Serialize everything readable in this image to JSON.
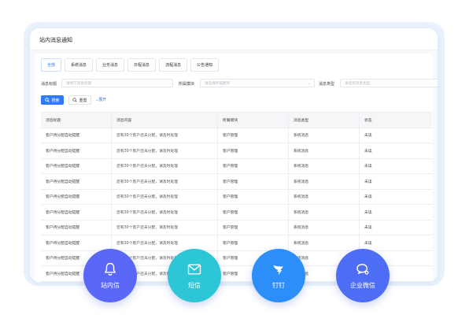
{
  "panel": {
    "title": "站内消息通知"
  },
  "tabs": [
    {
      "label": "全部",
      "active": true
    },
    {
      "label": "系统消息",
      "active": false
    },
    {
      "label": "业务消息",
      "active": false
    },
    {
      "label": "日程消息",
      "active": false
    },
    {
      "label": "流程消息",
      "active": false
    },
    {
      "label": "公告通知",
      "active": false
    }
  ],
  "filters": {
    "title_label": "消息标题",
    "title_placeholder": "请填写消息标题",
    "module_label": "所属模块",
    "module_placeholder": "请选择所属模块",
    "type_label": "消息类型",
    "type_placeholder": "请选择消息类型"
  },
  "buttons": {
    "search": "搜索",
    "reset": "重置",
    "expand": "展开"
  },
  "table": {
    "headers": [
      "消息标题",
      "消息内容",
      "所属模块",
      "消息类型",
      "状态"
    ],
    "rows": [
      [
        "客户待分配自动提醒",
        "您有30个客户还未分配，请及时处理",
        "客户管理",
        "系统消息",
        "未读"
      ],
      [
        "客户待分配自动提醒",
        "您有30个客户还未分配，请及时处理",
        "客户管理",
        "系统消息",
        "未读"
      ],
      [
        "客户待分配自动提醒",
        "您有30个客户还未分配，请及时处理",
        "客户管理",
        "系统消息",
        "未读"
      ],
      [
        "客户待分配自动提醒",
        "您有30个客户还未分配，请及时处理",
        "客户管理",
        "系统消息",
        "未读"
      ],
      [
        "客户待分配自动提醒",
        "您有30个客户还未分配，请及时处理",
        "客户管理",
        "系统消息",
        "未读"
      ],
      [
        "客户待分配自动提醒",
        "您有30个客户还未分配，请及时处理",
        "客户管理",
        "系统消息",
        "未读"
      ],
      [
        "客户待分配自动提醒",
        "您有30个客户还未分配，请及时处理",
        "客户管理",
        "系统消息",
        "未读"
      ],
      [
        "客户待分配自动提醒",
        "您有30个客户还未分配，请及时处理",
        "客户管理",
        "系统消息",
        "未读"
      ],
      [
        "客户待分配自动提醒",
        "您有30个客户还未分配，请及时处理",
        "客户管理",
        "系统消息",
        "未读"
      ],
      [
        "客户待分配自动提醒",
        "您有30个客户还未分配，请及时处理",
        "客户管理",
        "系统消息",
        "未读"
      ]
    ]
  },
  "channels": [
    {
      "label": "站内信",
      "icon": "bell-icon",
      "color": "#5b67f6"
    },
    {
      "label": "短信",
      "icon": "mail-icon",
      "color": "#2dc6d6"
    },
    {
      "label": "钉钉",
      "icon": "dingtalk-icon",
      "color": "#2c8ef8"
    },
    {
      "label": "企业微信",
      "icon": "wecom-icon",
      "color": "#4e6df5"
    }
  ],
  "colors": {
    "accent": "#2f7bf5",
    "frame": "#eaf2fd"
  }
}
